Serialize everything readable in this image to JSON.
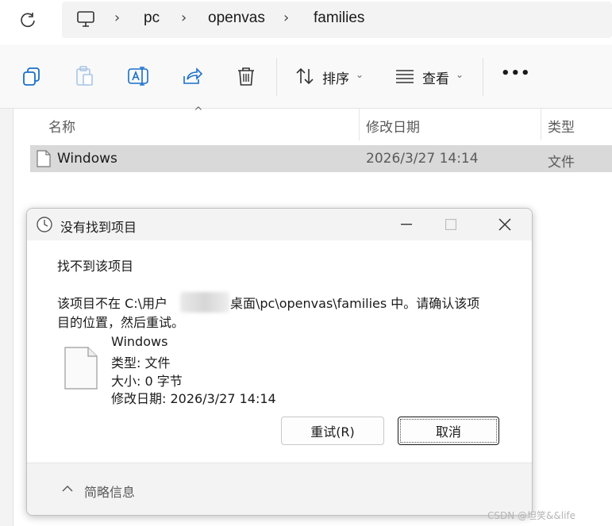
{
  "address_bar": {
    "crumbs": [
      "pc",
      "openvas",
      "families"
    ]
  },
  "toolbar": {
    "sort_label": "排序",
    "view_label": "查看",
    "more_label": "•••"
  },
  "file_list": {
    "columns": [
      "名称",
      "修改日期",
      "类型"
    ],
    "rows": [
      {
        "name": "Windows",
        "modified": "2026/3/27 14:14",
        "type": "文件"
      }
    ]
  },
  "dialog": {
    "title": "没有找到项目",
    "heading": "找不到该项目",
    "message_line1_a": "该项目不在 C:\\用户",
    "message_line1_b": "桌面\\pc\\openvas\\families 中。请确认该项",
    "message_line2": "目的位置，然后重试。",
    "file_name": "Windows",
    "file_type": "类型: 文件",
    "file_size": "大小: 0 字节",
    "file_modified": "修改日期: 2026/3/27 14:14",
    "retry_label": "重试(R)",
    "cancel_label": "取消",
    "details_label": "简略信息"
  },
  "watermark": "CSDN @坦笑&&life",
  "colors": {
    "selected_row": "#d9d9d9",
    "accent": "#005fb8",
    "toolbar_bg": "#f9f9f9"
  }
}
